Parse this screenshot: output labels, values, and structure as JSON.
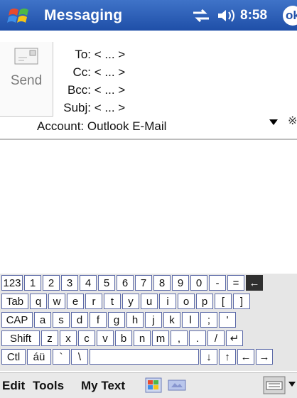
{
  "titlebar": {
    "app_title": "Messaging",
    "time": "8:58",
    "ok_label": "ok"
  },
  "header": {
    "send_label": "Send",
    "fields": [
      {
        "label": "To:",
        "value": "< ... >"
      },
      {
        "label": "Cc:",
        "value": "< ... >"
      },
      {
        "label": "Bcc:",
        "value": "< ... >"
      },
      {
        "label": "Subj:",
        "value": "< ... >"
      }
    ],
    "account": {
      "label": "Account:",
      "value": "Outlook E-Mail"
    }
  },
  "keyboard": {
    "rows": [
      [
        "123",
        "1",
        "2",
        "3",
        "4",
        "5",
        "6",
        "7",
        "8",
        "9",
        "0",
        "-",
        "=",
        "←"
      ],
      [
        "Tab",
        "q",
        "w",
        "e",
        "r",
        "t",
        "y",
        "u",
        "i",
        "o",
        "p",
        "[",
        "]"
      ],
      [
        "CAP",
        "a",
        "s",
        "d",
        "f",
        "g",
        "h",
        "j",
        "k",
        "l",
        ";",
        "'"
      ],
      [
        "Shift",
        "z",
        "x",
        "c",
        "v",
        "b",
        "n",
        "m",
        ",",
        ".",
        "/",
        "↵"
      ],
      [
        "Ctl",
        "áü",
        "`",
        "\\",
        "",
        "↓",
        "↑",
        "←",
        "→"
      ]
    ]
  },
  "menubar": {
    "items": [
      "Edit",
      "Tools",
      "My Text"
    ]
  },
  "colors": {
    "titlebar": "#1f4fa8",
    "key_border": "#5c6aa8"
  }
}
